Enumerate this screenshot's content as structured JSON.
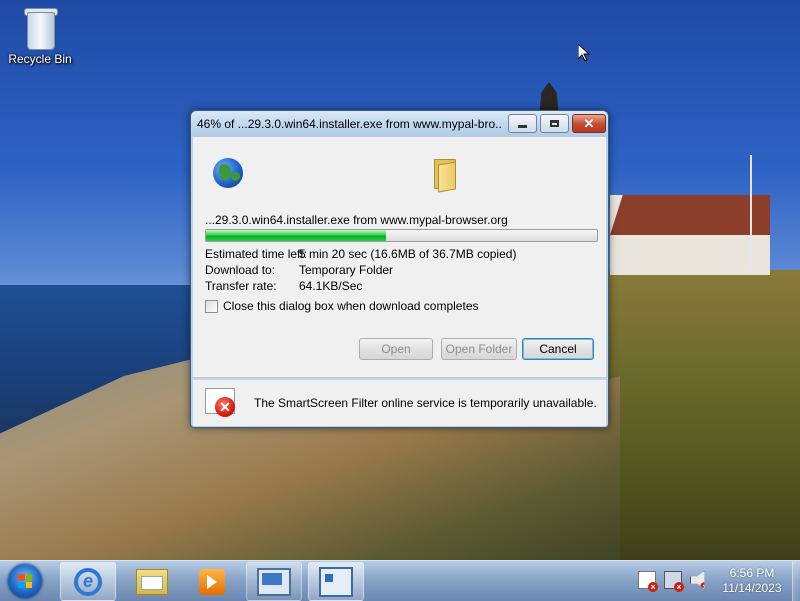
{
  "desktop": {
    "icons": [
      {
        "label": "Recycle Bin",
        "icon": "recycle-bin-icon"
      }
    ]
  },
  "dialog": {
    "title": "46% of ...29.3.0.win64.installer.exe from www.mypal-bro...",
    "file_line": "...29.3.0.win64.installer.exe from www.mypal-browser.org",
    "progress_percent": 46,
    "rows": [
      {
        "label": "Estimated time left:",
        "value": "5 min 20 sec (16.6MB of 36.7MB copied)"
      },
      {
        "label": "Download to:",
        "value": "Temporary Folder"
      },
      {
        "label": "Transfer rate:",
        "value": "64.1KB/Sec"
      }
    ],
    "close_checkbox_label": "Close this dialog box when download completes",
    "close_checkbox_checked": false,
    "buttons": {
      "open": "Open",
      "open_folder": "Open Folder",
      "cancel": "Cancel"
    },
    "smartscreen_message": "The SmartScreen Filter online service is temporarily unavailable.",
    "icons": [
      "globe-icon",
      "folder-icon",
      "smartscreen-error-icon"
    ]
  },
  "taskbar": {
    "pinned": [
      "start-orb-icon",
      "internet-explorer-icon",
      "windows-explorer-icon",
      "media-player-icon",
      "remote-desktop-icon",
      "control-panel-icon"
    ],
    "tray_icons": [
      "action-center-error-icon",
      "network-error-icon",
      "volume-muted-icon"
    ],
    "clock": {
      "time": "6:56 PM",
      "date": "11/14/2023"
    }
  },
  "colors": {
    "progress_fill": "#06b025",
    "accent": "#3c7fb1",
    "error": "#d51d0b"
  }
}
